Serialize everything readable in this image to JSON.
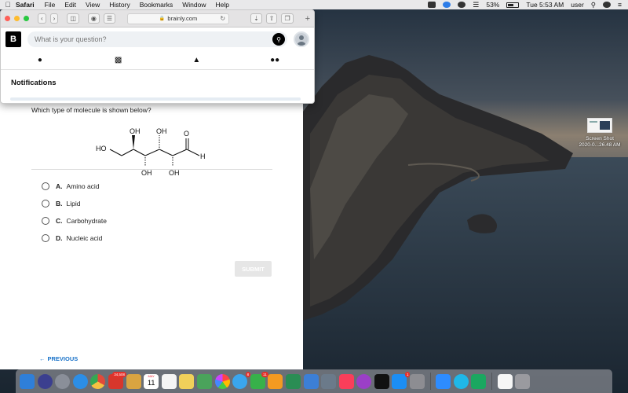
{
  "menubar": {
    "app_name": "Safari",
    "items": [
      "File",
      "Edit",
      "View",
      "History",
      "Bookmarks",
      "Window",
      "Help"
    ],
    "battery": "53%",
    "clock": "Tue 5:53 AM",
    "user": "user"
  },
  "safari": {
    "url": "brainly.com",
    "logo": "B",
    "search_placeholder": "What is your question?",
    "nav_icons": [
      "profile-icon",
      "messages-icon",
      "bell-icon",
      "friends-icon"
    ],
    "notifications_title": "Notifications"
  },
  "question": {
    "text": "Which type of molecule is shown below?",
    "molecule_labels": {
      "ho": "HO",
      "oh_top_1": "OH",
      "oh_top_2": "OH",
      "oh_bottom_1": "OH",
      "oh_bottom_2": "OH",
      "o": "O",
      "h": "H"
    },
    "options": [
      {
        "letter": "A.",
        "label": "Amino acid"
      },
      {
        "letter": "B.",
        "label": "Lipid"
      },
      {
        "letter": "C.",
        "label": "Carbohydrate"
      },
      {
        "letter": "D.",
        "label": "Nucleic acid"
      }
    ],
    "submit_label": "SUBMIT",
    "previous_label": "PREVIOUS"
  },
  "desktop_file": {
    "line1": "Screen Shot",
    "line2": "2020-0...26.48 AM"
  },
  "dock": {
    "calendar_month": "MAY",
    "calendar_day": "11",
    "badges": {
      "notes": "34,508",
      "messages": "8",
      "facetime": "11",
      "appstore": "1"
    }
  },
  "colors": {
    "brainly_black": "#000000",
    "link_blue": "#1a73c9",
    "submit_disabled": "#e6e6e6"
  }
}
